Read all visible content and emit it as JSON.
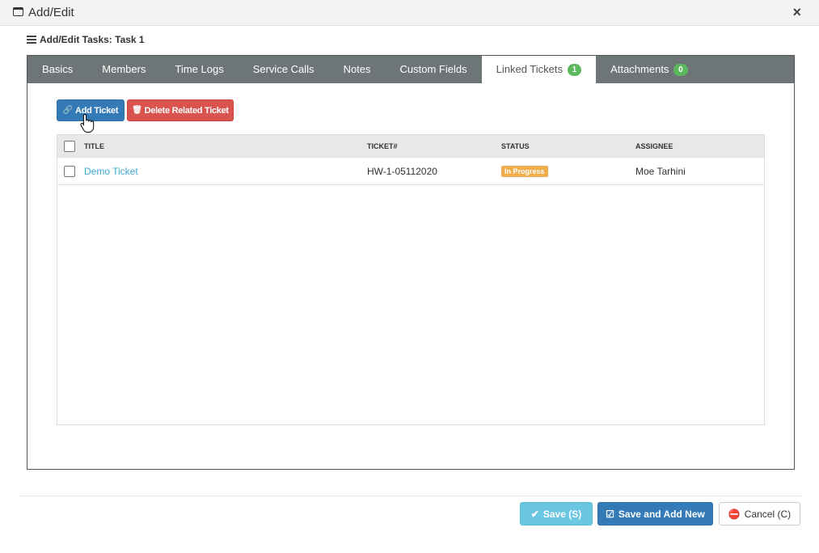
{
  "window": {
    "title": "Add/Edit",
    "close_label": "×"
  },
  "subtitle": "Add/Edit Tasks: Task 1",
  "tabs": [
    {
      "label": "Basics"
    },
    {
      "label": "Members"
    },
    {
      "label": "Time Logs"
    },
    {
      "label": "Service Calls"
    },
    {
      "label": "Notes"
    },
    {
      "label": "Custom Fields"
    },
    {
      "label": "Linked Tickets",
      "badge": "1"
    },
    {
      "label": "Attachments",
      "badge": "0"
    }
  ],
  "active_tab": "Linked Tickets",
  "toolbar": {
    "add_label": "Add Ticket",
    "delete_label": "Delete Related Ticket"
  },
  "table": {
    "columns": [
      "TITLE",
      "TICKET#",
      "STATUS",
      "ASSIGNEE"
    ],
    "rows": [
      {
        "title": "Demo Ticket",
        "ticket": "HW-1-05112020",
        "status": "In Progress",
        "assignee": "Moe Tarhini"
      }
    ]
  },
  "footer": {
    "save_label": "Save (S)",
    "save_add_label": "Save and Add New",
    "cancel_label": "Cancel (C)"
  },
  "colors": {
    "primary": "#337ab7",
    "danger": "#d9534f",
    "info": "#5bc0de",
    "warning": "#f0ad4e",
    "success": "#5cb85c",
    "tab_bar": "#6d7577"
  }
}
